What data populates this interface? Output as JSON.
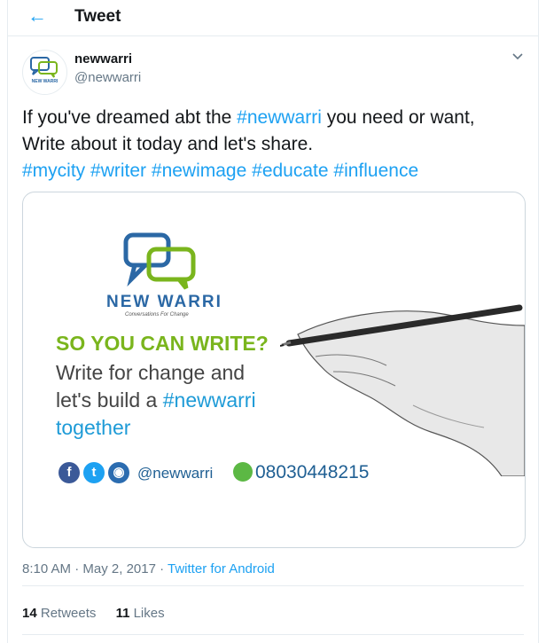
{
  "header": {
    "back_icon": "arrow-left-icon",
    "title": "Tweet"
  },
  "author": {
    "display_name": "newwarri",
    "handle": "@newwarri",
    "avatar_text": "NEW WARRI",
    "menu_icon": "chevron-down-icon"
  },
  "tweet": {
    "line1_prefix": "If you've dreamed abt the ",
    "line1_tag": "#newwarri",
    "line1_suffix": " you need or want,",
    "line2": "Write about it today and let's share.",
    "tags": [
      "#mycity",
      "#writer",
      "#newimage",
      "#educate",
      "#influence"
    ]
  },
  "media": {
    "brand": "NEW WARRI",
    "brand_tagline": "Conversations For Change",
    "headline": "SO YOU CAN WRITE?",
    "line1": "Write for change and",
    "line2_prefix": "let's build a ",
    "line2_tag": "#newwarri",
    "line3": "together",
    "social_handle": "@newwarri",
    "phone": "08030448215",
    "icons": [
      "facebook-icon",
      "twitter-icon",
      "instagram-icon",
      "whatsapp-icon"
    ]
  },
  "meta": {
    "time": "8:10 AM",
    "separator": " · ",
    "date": "May 2, 2017",
    "source": "Twitter for Android"
  },
  "stats": {
    "retweets_count": "14",
    "retweets_label": "Retweets",
    "likes_count": "11",
    "likes_label": "Likes"
  },
  "colors": {
    "accent": "#1da1f2",
    "green": "#7ab51d",
    "navy": "#1f5f93"
  }
}
